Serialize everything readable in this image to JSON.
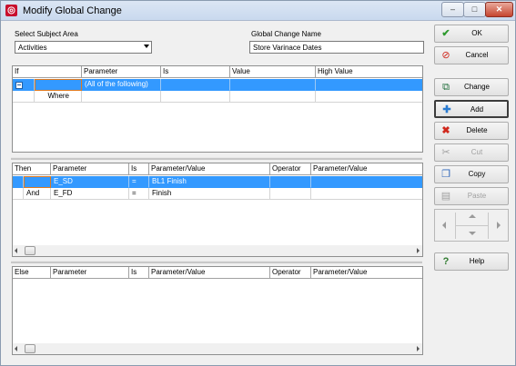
{
  "window": {
    "title": "Modify Global Change",
    "minimize": "–",
    "maximize": "□",
    "close": "✕"
  },
  "subject_area": {
    "label": "Select Subject Area",
    "value": "Activities"
  },
  "global_change_name": {
    "label": "Global Change Name",
    "value": "Store Varinace Dates"
  },
  "if_grid": {
    "columns": [
      "If",
      "Parameter",
      "Is",
      "Value",
      "High Value"
    ],
    "rows": [
      {
        "if": "",
        "parameter": "(All of the following)",
        "is": "",
        "value": "",
        "high_value": ""
      },
      {
        "if": "Where",
        "parameter": "",
        "is": "",
        "value": "",
        "high_value": ""
      }
    ]
  },
  "then_grid": {
    "columns": [
      "Then",
      "Parameter",
      "Is",
      "Parameter/Value",
      "Operator",
      "Parameter/Value"
    ],
    "rows": [
      {
        "then": "",
        "parameter": "E_SD",
        "is": "=",
        "param_value": "BL1 Finish",
        "operator": "",
        "param_value2": ""
      },
      {
        "then": "And",
        "parameter": "E_FD",
        "is": "=",
        "param_value": "Finish",
        "operator": "",
        "param_value2": ""
      }
    ]
  },
  "else_grid": {
    "columns": [
      "Else",
      "Parameter",
      "Is",
      "Parameter/Value",
      "Operator",
      "Parameter/Value"
    ],
    "rows": []
  },
  "buttons": {
    "ok": "OK",
    "cancel": "Cancel",
    "change": "Change",
    "add": "Add",
    "delete": "Delete",
    "cut": "Cut",
    "copy": "Copy",
    "paste": "Paste",
    "help": "Help"
  },
  "colors": {
    "selection": "#3399ff",
    "ok_check": "#2e9a2e",
    "cancel_red": "#d0281d"
  }
}
